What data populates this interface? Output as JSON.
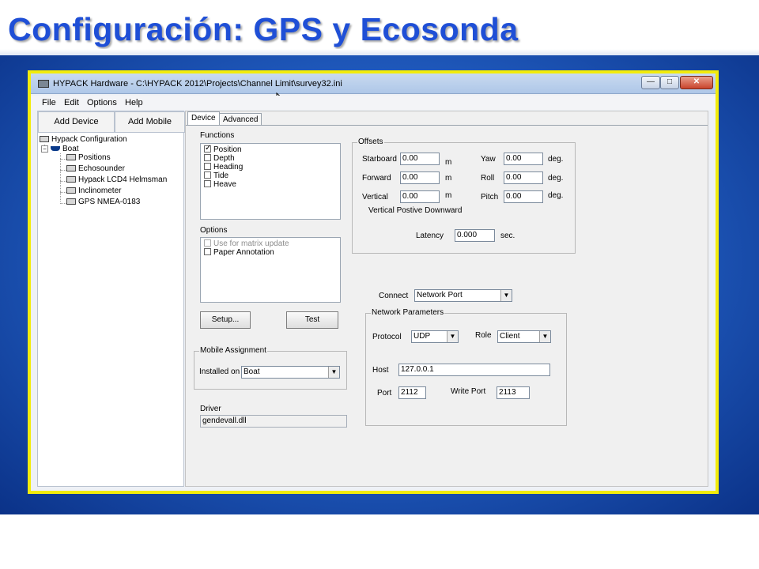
{
  "slide": {
    "title": "Configuración:  GPS y Ecosonda"
  },
  "window": {
    "title": "HYPACK Hardware - C:\\HYPACK 2012\\Projects\\Channel Limit\\survey32.ini",
    "minimize": "—",
    "maximize": "□",
    "close": "✕"
  },
  "menu": {
    "file": "File",
    "edit": "Edit",
    "options": "Options",
    "help": "Help"
  },
  "left_panel": {
    "add_device": "Add Device",
    "add_mobile": "Add Mobile",
    "tree": {
      "root": "Hypack Configuration",
      "boat": "Boat",
      "expander": "−",
      "devices": [
        "Positions",
        "Echosounder",
        "Hypack LCD4 Helmsman",
        "Inclinometer",
        "GPS NMEA-0183"
      ]
    }
  },
  "tabs": {
    "device": "Device",
    "advanced": "Advanced"
  },
  "functions": {
    "label": "Functions",
    "items": [
      {
        "label": "Position",
        "checked": true
      },
      {
        "label": "Depth",
        "checked": false
      },
      {
        "label": "Heading",
        "checked": false
      },
      {
        "label": "Tide",
        "checked": false
      },
      {
        "label": "Heave",
        "checked": false
      }
    ]
  },
  "options": {
    "label": "Options",
    "items": [
      {
        "label": "Use for matrix update",
        "checked": false,
        "disabled": true
      },
      {
        "label": "Paper Annotation",
        "checked": false,
        "disabled": false
      }
    ]
  },
  "buttons": {
    "setup": "Setup...",
    "test": "Test"
  },
  "mobile_assignment": {
    "title": "Mobile Assignment",
    "installed_on_label": "Installed on",
    "installed_on_value": "Boat"
  },
  "driver": {
    "label": "Driver",
    "value": "gendevall.dll"
  },
  "offsets": {
    "title": "Offsets",
    "starboard_label": "Starboard",
    "starboard_value": "0.00",
    "forward_label": "Forward",
    "forward_value": "0.00",
    "vertical_label": "Vertical",
    "vertical_value": "0.00",
    "yaw_label": "Yaw",
    "yaw_value": "0.00",
    "roll_label": "Roll",
    "roll_value": "0.00",
    "pitch_label": "Pitch",
    "pitch_value": "0.00",
    "unit_m": "m",
    "unit_deg": "deg.",
    "vertical_note": "Vertical Postive Downward",
    "latency_label": "Latency",
    "latency_value": "0.000",
    "latency_unit": "sec."
  },
  "connect": {
    "label": "Connect",
    "value": "Network Port"
  },
  "network": {
    "title": "Network Parameters",
    "protocol_label": "Protocol",
    "protocol_value": "UDP",
    "role_label": "Role",
    "role_value": "Client",
    "host_label": "Host",
    "host_value": "127.0.0.1",
    "port_label": "Port",
    "port_value": "2112",
    "write_port_label": "Write Port",
    "write_port_value": "2113"
  },
  "colors": {
    "title_blue": "#1f4fd6",
    "frame_yellow": "#f2ec0c",
    "background_blue": "#1e57b9"
  }
}
